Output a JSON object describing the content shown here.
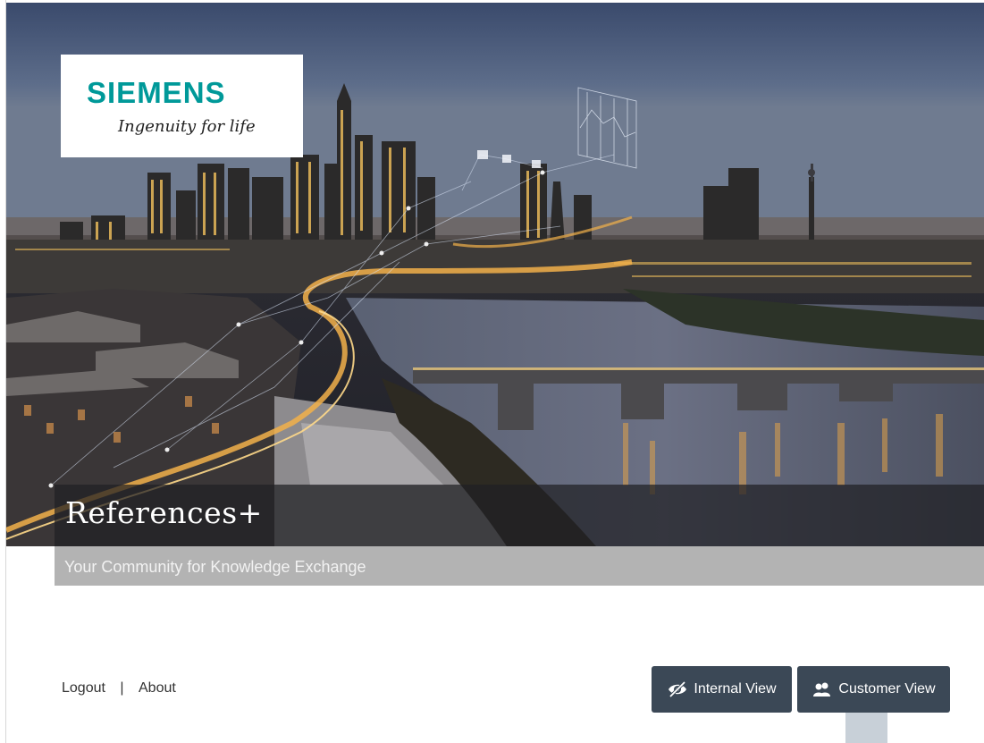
{
  "branding": {
    "company": "SIEMENS",
    "tagline": "Ingenuity for life",
    "brand_color": "#009999"
  },
  "hero": {
    "title": "References+",
    "subtitle": "Your Community for Knowledge Exchange"
  },
  "footer": {
    "logout_label": "Logout",
    "separator": "|",
    "about_label": "About"
  },
  "views": {
    "internal_label": "Internal View",
    "internal_icon": "eye-slash-icon",
    "customer_label": "Customer View",
    "customer_icon": "users-icon",
    "selected": "Customer View",
    "button_color": "#3b4856"
  }
}
